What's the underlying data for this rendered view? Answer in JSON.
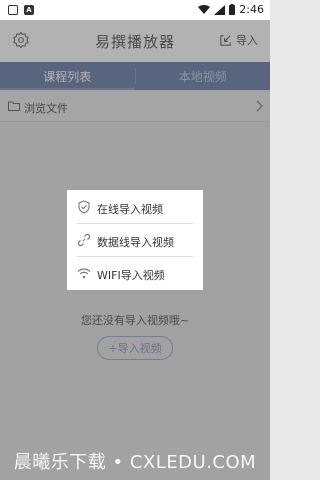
{
  "status_bar": {
    "time": "2:46",
    "icon_a_label": "A"
  },
  "header": {
    "title": "易撰播放器",
    "import_label": "导入"
  },
  "tabs": [
    {
      "label": "课程列表",
      "active": true
    },
    {
      "label": "本地视频",
      "active": false
    }
  ],
  "browse": {
    "label": "浏览文件"
  },
  "empty_state": {
    "text": "您还没有导入视频哦~",
    "button_label": "+导入视频"
  },
  "popup": {
    "items": [
      {
        "label": "在线导入视频",
        "icon": "shield-check-icon"
      },
      {
        "label": "数据线导入视频",
        "icon": "link-icon"
      },
      {
        "label": "WIFI导入视频",
        "icon": "wifi-icon"
      }
    ]
  },
  "watermark": "晨曦乐下载 • CXLEDU.COM",
  "colors": {
    "accent": "#7f91b5",
    "overlay": "rgba(0,0,0,0.3)",
    "button_outline": "#a9b6d1"
  }
}
